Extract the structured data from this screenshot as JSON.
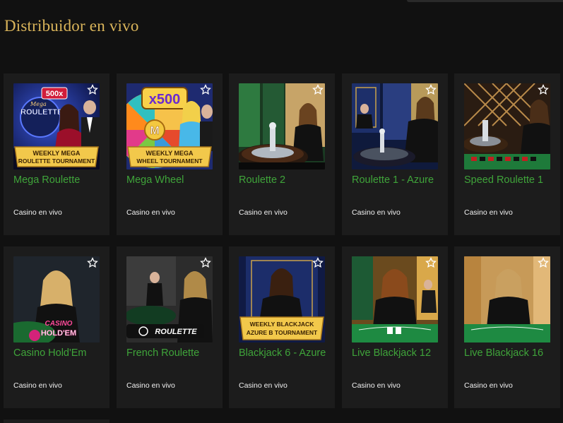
{
  "section": {
    "title": "Distribuidor en vivo"
  },
  "games": [
    {
      "name": "Mega Roulette",
      "category": "Casino en vivo",
      "badge": "500x",
      "logo_top": "Mega",
      "logo_main": "ROULETTE",
      "banner_line1": "WEEKLY MEGA",
      "banner_line2": "ROULETTE TOURNAMENT",
      "theme": "#1a2a8a"
    },
    {
      "name": "Mega Wheel",
      "category": "Casino en vivo",
      "badge": "x500",
      "logo_main": "M",
      "banner_line1": "WEEKLY MEGA",
      "banner_line2": "WHEEL TOURNAMENT",
      "theme": "#d08a20"
    },
    {
      "name": "Roulette 2",
      "category": "Casino en vivo",
      "theme": "#2a6a3a"
    },
    {
      "name": "Roulette 1 - Azure",
      "category": "Casino en vivo",
      "theme": "#1b2a5c"
    },
    {
      "name": "Speed Roulette 1",
      "category": "Casino en vivo",
      "theme": "#4a3320"
    },
    {
      "name": "Casino Hold'Em",
      "category": "Casino en vivo",
      "logo_top": "CASINO",
      "logo_main": "HOLD'EM",
      "theme": "#2b3038"
    },
    {
      "name": "French Roulette",
      "category": "Casino en vivo",
      "logo_main": "ROULETTE",
      "theme": "#3a3a3a"
    },
    {
      "name": "Blackjack 6 - Azure",
      "category": "Casino en vivo",
      "banner_line1": "WEEKLY BLACKJACK",
      "banner_line2": "AZURE B TOURNAMENT",
      "theme": "#1c2d6a"
    },
    {
      "name": "Live Blackjack 12",
      "category": "Casino en vivo",
      "theme": "#c78a2a"
    },
    {
      "name": "Live Blackjack 16",
      "category": "Casino en vivo",
      "theme": "#c9a068"
    }
  ],
  "colors": {
    "title": "#d9b45a",
    "game_name": "#3fa43a",
    "card_bg": "#1c1c1c",
    "page_bg": "#111111"
  },
  "icons": {
    "favorite": "star-outline-icon"
  }
}
